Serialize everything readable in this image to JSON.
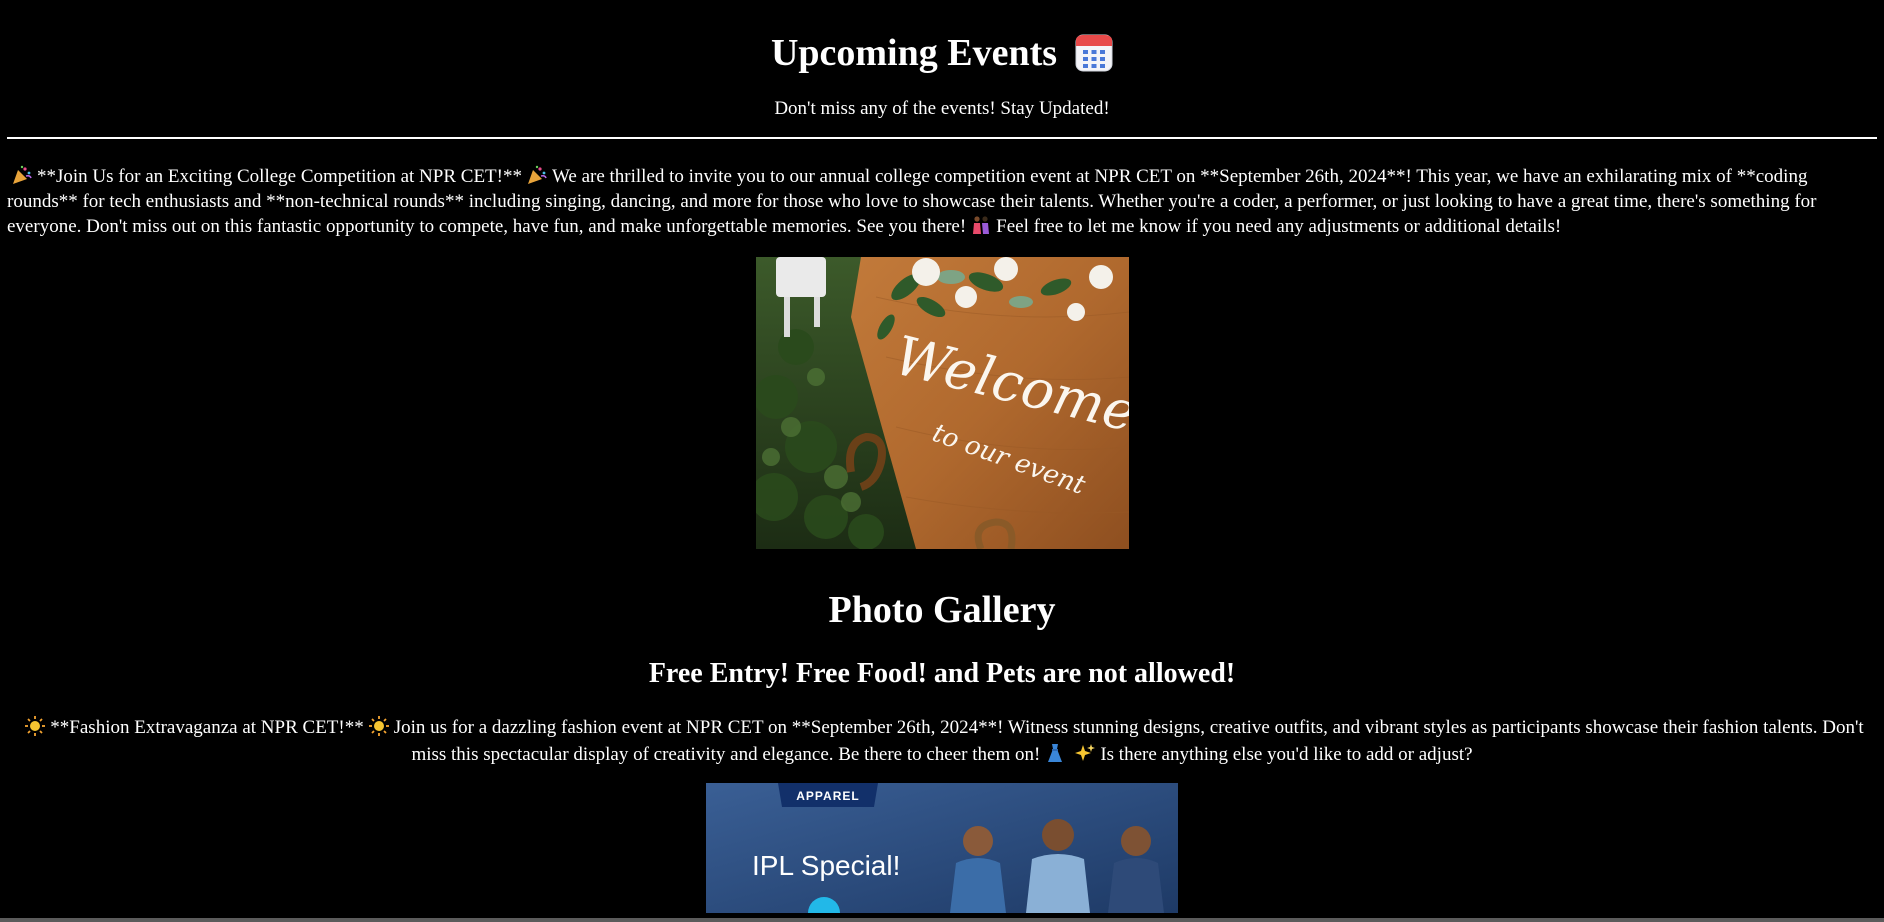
{
  "header": {
    "title": "Upcoming Events",
    "title_icon": "calendar-icon",
    "subtitle": "Don't miss any of the events! Stay Updated!"
  },
  "event": {
    "part1": "**Join Us for an Exciting College Competition at NPR CET!**",
    "part2": "We are thrilled to invite you to our annual college competition event at NPR CET on **September 26th, 2024**! This year, we have an exhilarating mix of **coding rounds** for tech enthusiasts and **non-technical rounds** including singing, dancing, and more for those who love to showcase their talents. Whether you're a coder, a performer, or just looking to have a great time, there's something for everyone. Don't miss out on this fantastic opportunity to compete, have fun, and make unforgettable memories. See you there!",
    "part3": "Feel free to let me know if you need any adjustments or additional details!",
    "icons": [
      "party-popper-icon",
      "party-popper-icon",
      "dancing-couple-icon"
    ],
    "image": {
      "line1": "Welcome",
      "line2": "to our event"
    }
  },
  "gallery": {
    "title": "Photo Gallery",
    "subtitle": "Free Entry! Free Food! and Pets are not allowed!"
  },
  "fashion": {
    "part1": "**Fashion Extravaganza at NPR CET!**",
    "part2": "Join us for a dazzling fashion event at NPR CET on **September 26th, 2024**! Witness stunning designs, creative outfits, and vibrant styles as participants showcase their fashion talents. Don't miss this spectacular display of creativity and elegance. Be there to cheer them on!",
    "part3": "Is there anything else you'd like to add or adjust?",
    "icons": [
      "sun-icon",
      "sun-icon",
      "dress-icon",
      "sparkles-icon"
    ],
    "image": {
      "badge": "APPAREL",
      "headline": "IPL Special!"
    }
  },
  "colors": {
    "background": "#000000",
    "text": "#ffffff",
    "apparel_bg": "#2b4a78",
    "wood": "#b0692e"
  }
}
